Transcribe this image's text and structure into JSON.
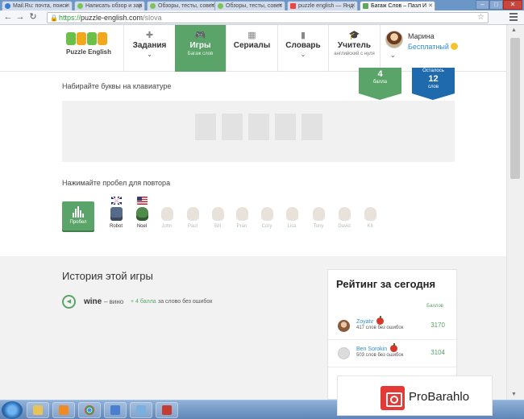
{
  "browser": {
    "tabs": [
      {
        "title": "Mail.Ru: почта, поиск",
        "icon": "mail-icon"
      },
      {
        "title": "Написать обзор и зар",
        "icon": "site-icon"
      },
      {
        "title": "Обзоры, тесты, совет",
        "icon": "site-icon"
      },
      {
        "title": "Обзоры, тесты, совет",
        "icon": "site-icon"
      },
      {
        "title": "puzzle english — Янд",
        "icon": "yandex-icon"
      },
      {
        "title": "Багаж Слов – Пазл И",
        "icon": "puzzle-icon",
        "active": true
      }
    ],
    "url_scheme": "https://",
    "url_host": "puzzle-english.com",
    "url_path": "/slova",
    "window_controls": {
      "minimize": "–",
      "maximize": "□",
      "close": "✕"
    }
  },
  "header": {
    "logo_text": "Puzzle English",
    "nav": [
      {
        "label": "Задания",
        "sub": "",
        "icon": "puzzle-icon",
        "chevron": true
      },
      {
        "label": "Игры",
        "sub": "Багаж слов",
        "icon": "gamepad-icon",
        "active": true
      },
      {
        "label": "Сериалы",
        "sub": "",
        "icon": "clapperboard-icon"
      },
      {
        "label": "Словарь",
        "sub": "",
        "icon": "book-icon",
        "chevron": true
      },
      {
        "label": "Учитель",
        "sub": "английский с нуля",
        "icon": "graduation-cap-icon"
      }
    ],
    "user": {
      "name": "Марина",
      "plan": "Бесплатный"
    }
  },
  "game": {
    "instruction_type": "Набирайте буквы на клавиатуре",
    "points_badge": {
      "value": "4",
      "label": "балла"
    },
    "remaining_badge": {
      "label_top": "Осталось",
      "value": "12",
      "label": "слов"
    },
    "letter_slots": 5,
    "instruction_repeat": "Нажимайте пробел для повтора",
    "play_button_label": "Пробел",
    "voices": [
      {
        "name": "Robot",
        "flag": "uk",
        "enabled": true
      },
      {
        "name": "Noel",
        "flag": "us",
        "enabled": true
      },
      {
        "name": "John",
        "flag": "none",
        "enabled": false
      },
      {
        "name": "Paul",
        "flag": "none",
        "enabled": false
      },
      {
        "name": "Bill",
        "flag": "none",
        "enabled": false
      },
      {
        "name": "Pran",
        "flag": "none",
        "enabled": false
      },
      {
        "name": "Cory",
        "flag": "none",
        "enabled": false
      },
      {
        "name": "Lisa",
        "flag": "none",
        "enabled": false
      },
      {
        "name": "Tony",
        "flag": "none",
        "enabled": false
      },
      {
        "name": "David",
        "flag": "none",
        "enabled": false
      },
      {
        "name": "Kit",
        "flag": "none",
        "enabled": false
      }
    ]
  },
  "history": {
    "title": "История этой игры",
    "items": [
      {
        "word": "wine",
        "translation": "– вино",
        "points": "+ 4 балла",
        "note": "за слово без ошибок"
      }
    ]
  },
  "rating": {
    "title": "Рейтинг за сегодня",
    "points_header": "Баллов",
    "entries": [
      {
        "name": "Zoyatv",
        "summary": "417 слов без ошибок",
        "score": "3170"
      },
      {
        "name": "Ben Sorokin",
        "summary": "503 слов без ошибок",
        "score": "3104"
      }
    ]
  },
  "watermark": {
    "text": "ProBarahlo"
  },
  "colors": {
    "brand_green": "#5aa469",
    "brand_blue": "#1f69ad",
    "link_blue": "#2f8fd3"
  }
}
